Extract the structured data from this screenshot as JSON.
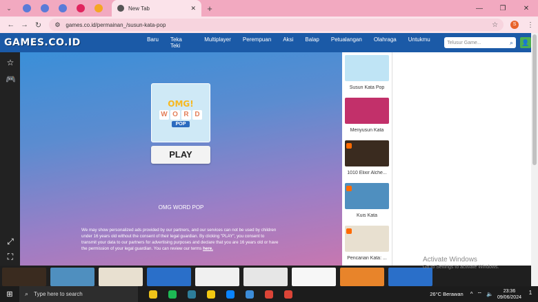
{
  "browser": {
    "tabs": [
      {
        "favicon_color": "#5a7bd8"
      },
      {
        "favicon_color": "#5a7bd8"
      },
      {
        "favicon_color": "#5a7bd8"
      },
      {
        "favicon_color": "#e0245e"
      },
      {
        "favicon_color": "#f5a623"
      }
    ],
    "active_tab_title": "New Tab",
    "url": "games.co.id/permainan_/susun-kata-pop",
    "profile_initial": "S"
  },
  "site": {
    "logo": "GAMES.CO.ID",
    "nav": [
      "Baru",
      "Teka Teki",
      "Multiplayer",
      "Perempuan",
      "Aksi",
      "Balap",
      "Petualangan",
      "Olahraga",
      "Untukmu"
    ],
    "search_placeholder": "Telusur Game..."
  },
  "game": {
    "cover_omg": "OMG!",
    "cover_letters": [
      "W",
      "O",
      "R",
      "D"
    ],
    "cover_pop": "POP",
    "play_label": "PLAY",
    "title": "OMG WORD POP",
    "consent_text": "We may show personalized ads provided by our partners, and our services can not be used by children under 16 years old without the consent of their legal guardian. By clicking \"PLAY\", you consent to transmit your data to our partners for advertising purposes and declare that you are 16 years old or have the permission of your legal guardian. You can review our terms",
    "consent_link": "here."
  },
  "side_games": [
    {
      "label": "Susun Kata Pop",
      "color": "#bfe4f5"
    },
    {
      "label": "Menyusun Kata",
      "color": "#c2306a"
    },
    {
      "label": "1010 Elixir Alche...",
      "color": "#3a2b1f"
    },
    {
      "label": "Kuis Kata",
      "color": "#4f8fbf"
    },
    {
      "label": "Pencarian Kata: ...",
      "color": "#e8e0d0"
    }
  ],
  "bottom_games": [
    {
      "color": "#3a2b1f"
    },
    {
      "color": "#4f8fbf"
    },
    {
      "color": "#e8e0d0"
    },
    {
      "color": "#2a6fc9"
    },
    {
      "color": "#f0f0f0"
    },
    {
      "color": "#e6e6e6"
    },
    {
      "color": "#f7f7f7"
    },
    {
      "color": "#e8842a"
    },
    {
      "color": "#2a6fc9"
    }
  ],
  "watermark": {
    "title": "Activate Windows",
    "subtitle": "Go to Settings to activate Windows."
  },
  "taskbar": {
    "search_placeholder": "Type here to search",
    "weather": "26°C  Berawan",
    "time": "23:36",
    "date": "09/06/2024",
    "notif_count": "1",
    "apps": [
      "#f0c419",
      "#1db954",
      "#2d7d9a",
      "#f2c811",
      "#0a84ff",
      "#3c8cd9",
      "#db4437",
      "#db4437"
    ]
  }
}
